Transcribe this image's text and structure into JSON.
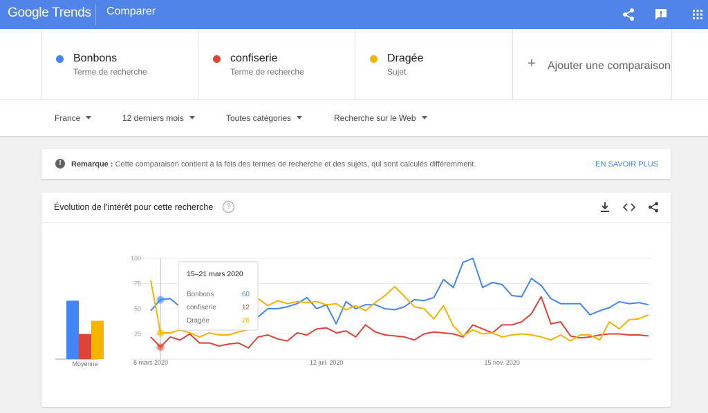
{
  "header": {
    "logo_text": "Google Trends",
    "title": "Comparer",
    "icons": [
      "share-icon",
      "feedback-icon",
      "apps-grid-icon"
    ]
  },
  "terms": [
    {
      "name": "Bonbons",
      "type": "Terme de recherche",
      "color": "#4285f4"
    },
    {
      "name": "confiserie",
      "type": "Terme de recherche",
      "color": "#db4437"
    },
    {
      "name": "Dragée",
      "type": "Sujet",
      "color": "#f4b400"
    }
  ],
  "add_comparison": "Ajouter une comparaison",
  "filters": {
    "region": "France",
    "period": "12 derniers mois",
    "category": "Toutes catégories",
    "search_type": "Recherche sur le Web"
  },
  "note": {
    "label": "Remarque :",
    "text": " Cette comparaison contient à la fois des termes de recherche et des sujets, qui sont calculés différemment.",
    "link": "EN SAVOIR PLUS"
  },
  "chart_card": {
    "title": "Évolution de l'intérêt pour cette recherche",
    "help": "?",
    "icons": [
      "download-icon",
      "embed-code-icon",
      "share-icon"
    ]
  },
  "chart_data": {
    "type": "line",
    "ylim": [
      0,
      100
    ],
    "yticks": [
      25,
      50,
      75,
      100
    ],
    "xtick_labels": [
      {
        "label": "8 mars 2020",
        "index": 0
      },
      {
        "label": "12 juil. 2020",
        "index": 18
      },
      {
        "label": "15 nov. 2020",
        "index": 36
      }
    ],
    "series": [
      {
        "name": "Bonbons",
        "color": "#4285f4",
        "values": [
          48,
          59,
          60,
          52,
          47,
          52,
          57,
          63,
          62,
          52,
          59,
          42,
          50,
          50,
          52,
          55,
          61,
          50,
          54,
          35,
          57,
          50,
          54,
          54,
          50,
          49,
          52,
          59,
          58,
          61,
          79,
          71,
          96,
          100,
          71,
          76,
          74,
          63,
          62,
          80,
          73,
          60,
          55,
          55,
          55,
          44,
          48,
          51,
          57,
          55,
          56,
          54
        ]
      },
      {
        "name": "confiserie",
        "color": "#db4437",
        "values": [
          22,
          12,
          22,
          19,
          25,
          16,
          16,
          13,
          15,
          16,
          11,
          22,
          24,
          20,
          18,
          26,
          24,
          30,
          31,
          26,
          28,
          22,
          34,
          27,
          24,
          23,
          22,
          19,
          25,
          27,
          26,
          25,
          22,
          34,
          30,
          26,
          34,
          34,
          37,
          45,
          62,
          35,
          37,
          23,
          21,
          22,
          24,
          25,
          25,
          24,
          24,
          23
        ]
      },
      {
        "name": "Dragée",
        "color": "#f4b400",
        "values": [
          78,
          26,
          26,
          29,
          26,
          22,
          26,
          24,
          24,
          27,
          29,
          60,
          53,
          58,
          55,
          57,
          56,
          57,
          54,
          55,
          49,
          53,
          48,
          56,
          63,
          72,
          62,
          52,
          50,
          40,
          53,
          33,
          23,
          29,
          25,
          26,
          22,
          24,
          25,
          24,
          22,
          19,
          24,
          18,
          24,
          24,
          19,
          37,
          30,
          39,
          40,
          44
        ]
      }
    ],
    "averages": [
      {
        "name": "Bonbons",
        "value": 58,
        "color": "#4285f4"
      },
      {
        "name": "confiserie",
        "value": 25,
        "color": "#db4437"
      },
      {
        "name": "Dragée",
        "value": 38,
        "color": "#f4b400"
      }
    ],
    "average_label": "Moyenne",
    "tooltip": {
      "date": "15–21 mars 2020",
      "index": 1,
      "rows": [
        {
          "name": "Bonbons",
          "value": "60",
          "color": "#4285f4"
        },
        {
          "name": "confiserie",
          "value": "12",
          "color": "#db4437"
        },
        {
          "name": "Dragée",
          "value": "26",
          "color": "#f4b400"
        }
      ]
    }
  }
}
